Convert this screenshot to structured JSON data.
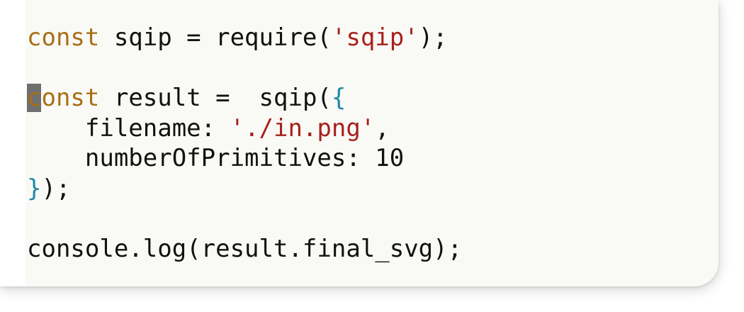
{
  "editor": {
    "line1": {
      "keyword": "const",
      "text_a": " sqip = require(",
      "string": "'sqip'",
      "text_b": ");"
    },
    "line3": {
      "cursor_char": "c",
      "keyword_rest": "onst",
      "text_a": " result =  sqip(",
      "brace_open": "{"
    },
    "line4": {
      "indent": "    ",
      "text_a": "filename: ",
      "string": "'./in.png'",
      "text_b": ","
    },
    "line5": {
      "indent": "    ",
      "text_a": "numberOfPrimitives: 10"
    },
    "line6": {
      "brace_close": "}",
      "text_a": ");"
    },
    "line8": {
      "text_a": "console.log(result.final_svg);"
    }
  },
  "colors": {
    "background": "#f9f9f6",
    "keyword": "#a86f16",
    "string": "#a8201a",
    "brace": "#1b8aa6",
    "text": "#111111",
    "cursor": "#6f6f6f"
  }
}
